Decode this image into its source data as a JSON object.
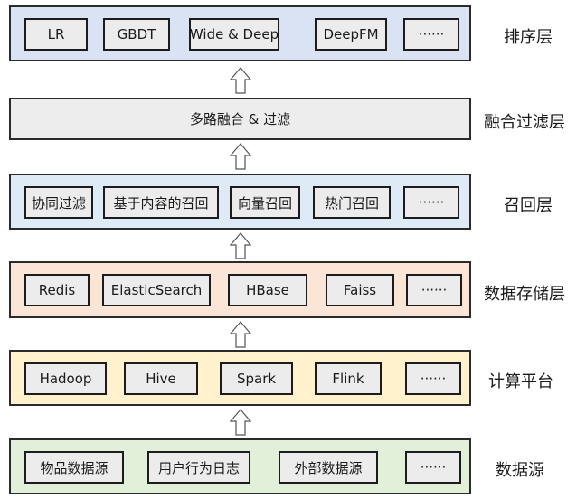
{
  "layers": {
    "ranking": {
      "label": "排序层",
      "color": "#dae3f3",
      "items": [
        "LR",
        "GBDT",
        "Wide & Deep",
        "DeepFM",
        "······"
      ]
    },
    "fusion": {
      "label": "融合过滤层",
      "color": "#ededed",
      "text": "多路融合 & 过滤"
    },
    "recall": {
      "label": "召回层",
      "color": "#deebf7",
      "items": [
        "协同过滤",
        "基于内容的召回",
        "向量召回",
        "热门召回",
        "······"
      ]
    },
    "storage": {
      "label": "数据存储层",
      "color": "#fbe5d6",
      "items": [
        "Redis",
        "ElasticSearch",
        "HBase",
        "Faiss",
        "······"
      ]
    },
    "compute": {
      "label": "计算平台",
      "color": "#fff2cc",
      "items": [
        "Hadoop",
        "Hive",
        "Spark",
        "Flink",
        "······"
      ]
    },
    "source": {
      "label": "数据源",
      "color": "#e2f0d9",
      "items": [
        "物品数据源",
        "用户行为日志",
        "外部数据源",
        "······"
      ]
    }
  },
  "item_fill": "#ececec",
  "arrow_icon": "hollow-up-arrow"
}
